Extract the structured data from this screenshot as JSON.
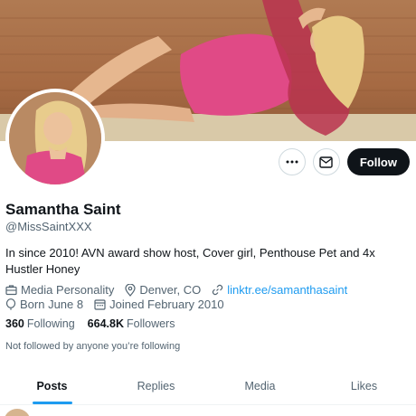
{
  "profile": {
    "name": "Samantha Saint",
    "handle": "@MissSaintXXX",
    "bio": "In since 2010! AVN award show host, Cover girl, Penthouse Pet and 4x Hustler Honey",
    "category": "Media Personality",
    "location": "Denver, CO",
    "website": "linktr.ee/samanthasaint",
    "birthday": "Born June 8",
    "joined": "Joined February 2010"
  },
  "stats": {
    "following_count": "360",
    "following_label": "Following",
    "followers_count": "664.8K",
    "followers_label": "Followers"
  },
  "social_context": "Not followed by anyone you’re following",
  "actions": {
    "follow_label": "Follow",
    "more_icon": "more-icon",
    "message_icon": "envelope-icon"
  },
  "tabs": [
    {
      "label": "Posts",
      "active": true
    },
    {
      "label": "Replies",
      "active": false
    },
    {
      "label": "Media",
      "active": false
    },
    {
      "label": "Likes",
      "active": false
    }
  ],
  "colors": {
    "accent": "#1d9bf0",
    "text_primary": "#0f1419",
    "text_secondary": "#536471",
    "follow_button": "#0f1419"
  }
}
